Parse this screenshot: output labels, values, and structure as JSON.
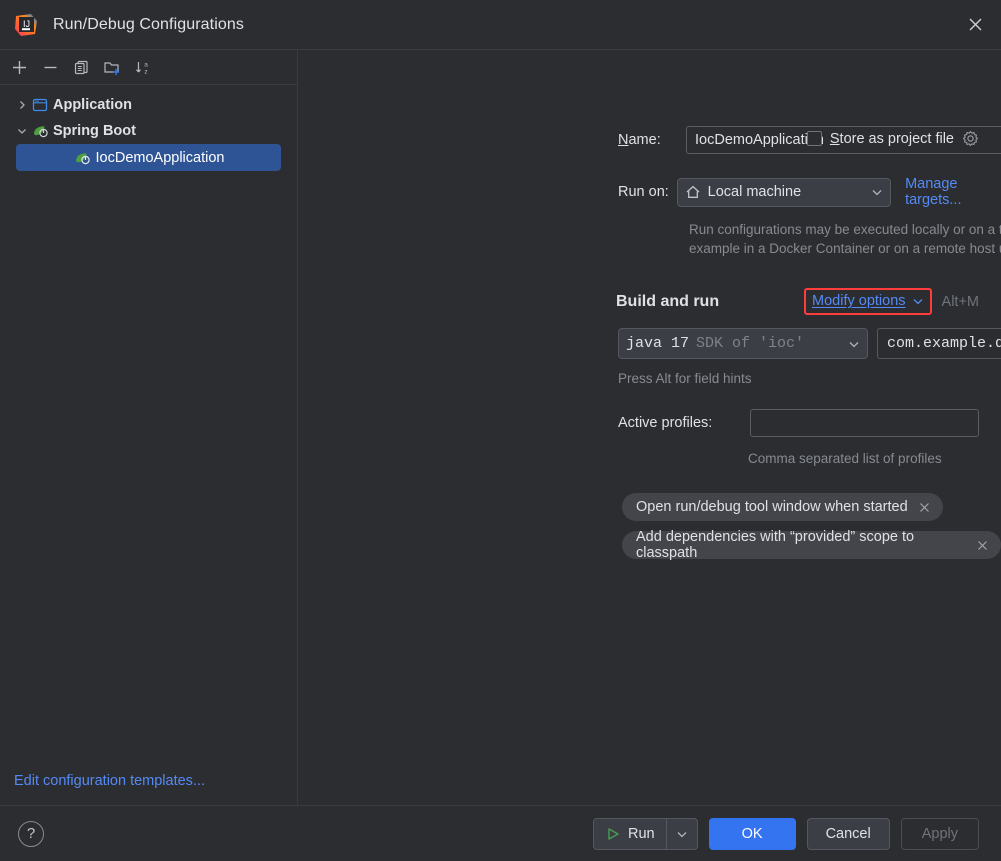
{
  "window": {
    "title": "Run/Debug Configurations",
    "logo_icon": "intellij-idea-logo",
    "close_icon": "close-icon"
  },
  "sidebar": {
    "toolbar": [
      {
        "name": "add",
        "icon": "plus-icon"
      },
      {
        "name": "remove",
        "icon": "minus-icon"
      },
      {
        "name": "copy",
        "icon": "copy-icon"
      },
      {
        "name": "new-folder",
        "icon": "folder-add-icon"
      },
      {
        "name": "sort-alphabetically",
        "icon": "sort-az-icon"
      }
    ],
    "tree": [
      {
        "label": "Application",
        "icon": "application-icon",
        "expanded": false,
        "chevron": "chevron-right-icon"
      },
      {
        "label": "Spring Boot",
        "icon": "spring-boot-icon",
        "expanded": true,
        "chevron": "chevron-down-icon"
      },
      {
        "label": "IocDemoApplication",
        "icon": "spring-boot-run-icon",
        "selected": true
      }
    ],
    "edit_templates_link": "Edit configuration templates..."
  },
  "form": {
    "name_label": "Name:",
    "name_label_mnemonic": "N",
    "name_value": "IocDemoApplication",
    "store_as_project_file_label": "tore as project file",
    "store_as_project_file_mnemonic": "S",
    "store_as_project_file_checked": false,
    "store_gear_icon": "gear-icon",
    "run_on_label": "Run on:",
    "run_on_value": "Local machine",
    "run_on_icon": "home-icon",
    "manage_targets_link": "Manage targets...",
    "target_hint_line1": "Run configurations may be executed locally or on a target: for",
    "target_hint_line2": "example in a Docker Container or on a remote host using SSH.",
    "build_and_run_title": "Build and run",
    "modify_options_link": "odify options",
    "modify_options_mnemonic": "M",
    "modify_options_shortcut": "Alt+M",
    "jdk_main": "java 17",
    "jdk_sub": "SDK of 'ioc'",
    "main_class_value": "com.example.demo.IocDemoApplication",
    "main_class_browse_icon": "class-chooser-icon",
    "field_hints_text": "Press Alt for field hints",
    "active_profiles_label": "Active profiles:",
    "active_profiles_value": "",
    "active_profiles_hint": "Comma separated list of profiles",
    "option_chips": [
      {
        "label": "Open run/debug tool window when started",
        "remove_icon": "close-small-icon"
      },
      {
        "label": "Add dependencies with “provided” scope to classpath",
        "remove_icon": "close-small-icon"
      }
    ]
  },
  "footer": {
    "help_label": "?",
    "run_label": "Run",
    "run_icon": "play-icon",
    "run_dropdown_icon": "chevron-down-icon",
    "ok_label": "OK",
    "cancel_label": "Cancel",
    "apply_label": "Apply",
    "apply_enabled": false
  },
  "colors": {
    "background": "#2b2d30",
    "panel_border": "#393b40",
    "accent_blue": "#3574f0",
    "link_blue": "#548af7",
    "selection_blue": "#2f5496",
    "highlight_red": "#ff3d3d",
    "play_green": "#499c54",
    "muted_text": "#878a91"
  }
}
